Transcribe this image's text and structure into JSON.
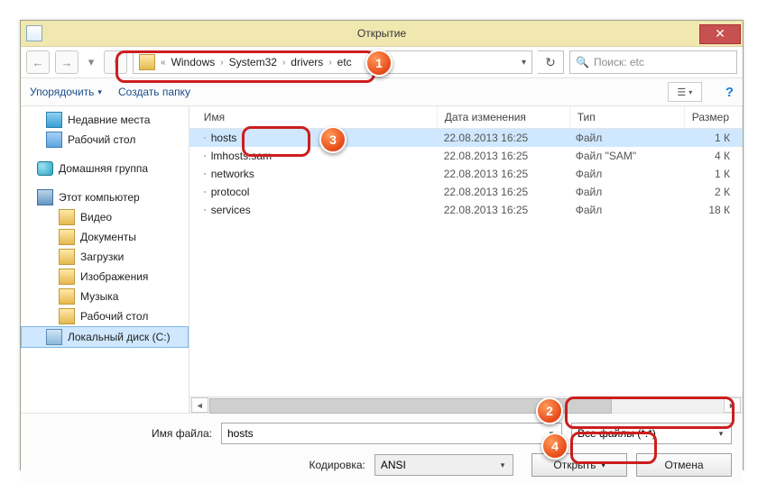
{
  "title": "Открытие",
  "close_label": "✕",
  "nav": {
    "back": "←",
    "fwd": "→",
    "recent_dd": "▾",
    "up": "↑",
    "refresh": "↻",
    "dd": "▾"
  },
  "breadcrumb": {
    "prefix": "«",
    "parts": [
      "Windows",
      "System32",
      "drivers",
      "etc"
    ],
    "sep": "›"
  },
  "search": {
    "placeholder": "Поиск: etc",
    "icon": "🔍"
  },
  "toolbar": {
    "organize": "Упорядочить",
    "newfolder": "Создать папку",
    "view_icon": "☰",
    "dd": "▾",
    "help": "?"
  },
  "sidebar": {
    "recent": "Недавние места",
    "desktop": "Рабочий стол",
    "homegroup": "Домашняя группа",
    "computer": "Этот компьютер",
    "items": [
      {
        "label": "Видео",
        "ic": "folder"
      },
      {
        "label": "Документы",
        "ic": "folder"
      },
      {
        "label": "Загрузки",
        "ic": "folder"
      },
      {
        "label": "Изображения",
        "ic": "folder"
      },
      {
        "label": "Музыка",
        "ic": "folder"
      },
      {
        "label": "Рабочий стол",
        "ic": "folder"
      },
      {
        "label": "Локальный диск (C:)",
        "ic": "disk"
      }
    ]
  },
  "columns": {
    "name": "Имя",
    "date": "Дата изменения",
    "type": "Тип",
    "size": "Размер"
  },
  "files": [
    {
      "name": "hosts",
      "date": "22.08.2013 16:25",
      "type": "Файл",
      "size": "1 К",
      "selected": true
    },
    {
      "name": "lmhosts.sam",
      "date": "22.08.2013 16:25",
      "type": "Файл \"SAM\"",
      "size": "4 К"
    },
    {
      "name": "networks",
      "date": "22.08.2013 16:25",
      "type": "Файл",
      "size": "1 К"
    },
    {
      "name": "protocol",
      "date": "22.08.2013 16:25",
      "type": "Файл",
      "size": "2 К"
    },
    {
      "name": "services",
      "date": "22.08.2013 16:25",
      "type": "Файл",
      "size": "18 К"
    }
  ],
  "bottom": {
    "name_label": "Имя файла:",
    "name_value": "hosts",
    "filter_value": "Все файлы (*.*)",
    "encoding_label": "Кодировка:",
    "encoding_value": "ANSI",
    "open": "Открыть",
    "cancel": "Отмена",
    "dd": "▾"
  },
  "callouts": [
    "1",
    "2",
    "3",
    "4"
  ]
}
